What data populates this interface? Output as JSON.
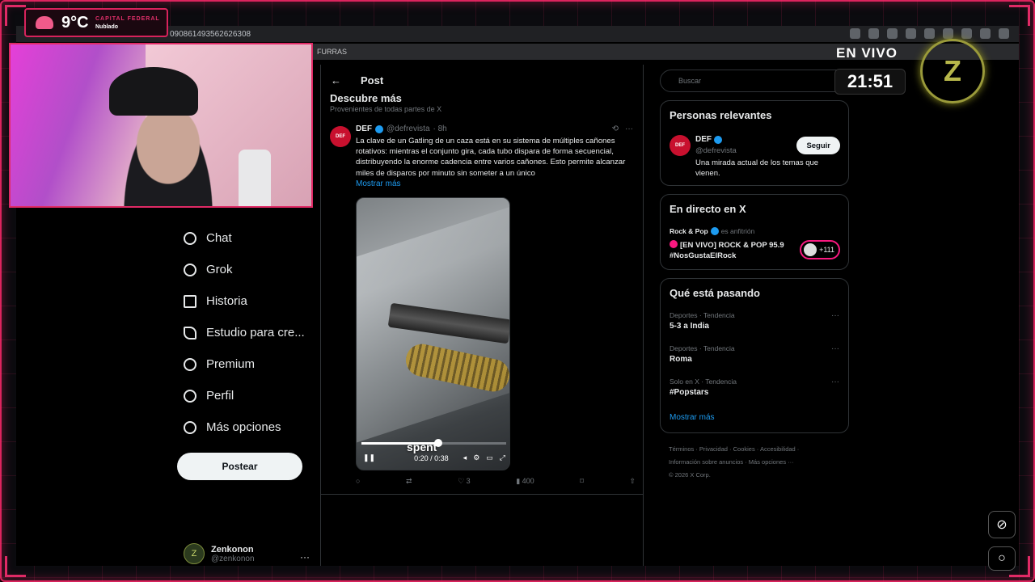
{
  "overlay": {
    "weather": {
      "temp": "9°C",
      "city": "CAPITAL FEDERAL",
      "condition": "Nublado"
    },
    "live_label": "EN VIVO",
    "clock": "21:51",
    "logo": "Z"
  },
  "browser": {
    "url": "090861493562626308",
    "bookmark": "FURRAS"
  },
  "nav": {
    "items": [
      {
        "label": "Chat",
        "icon": "chat-icon"
      },
      {
        "label": "Grok",
        "icon": "grok-icon"
      },
      {
        "label": "Historia",
        "icon": "bookmark-icon"
      },
      {
        "label": "Estudio para cre...",
        "icon": "rocket-icon"
      },
      {
        "label": "Premium",
        "icon": "verified-icon"
      },
      {
        "label": "Perfil",
        "icon": "person-icon"
      },
      {
        "label": "Más opciones",
        "icon": "more-icon"
      }
    ],
    "post_button": "Postear",
    "account": {
      "name": "Zenkonon",
      "handle": "@zenkonon",
      "more": "···"
    }
  },
  "main": {
    "header": {
      "back": "←",
      "title": "Post"
    },
    "discover": {
      "title": "Descubre más",
      "subtitle": "Provenientes de todas partes de X"
    },
    "tweet": {
      "avatar": "DEF",
      "name": "DEF",
      "handle": "@defrevista",
      "time": "· 8h",
      "text": "La clave de un Gatling de un caza está en su sistema de múltiples cañones rotativos: mientras el conjunto gira, cada tubo dispara de forma secuencial, distribuyendo la enorme cadencia entre varios cañones. Esto permite alcanzar miles de disparos por minuto sin someter a un único",
      "show_more": "Mostrar más",
      "video": {
        "caption": "spent",
        "time": "0:20 / 0:38",
        "progress": 0.53
      },
      "stats": {
        "likes": "3",
        "views": "400"
      }
    }
  },
  "right": {
    "search_placeholder": "Buscar",
    "relevant": {
      "title": "Personas relevantes",
      "avatar": "DEF",
      "name": "DEF",
      "handle": "@defrevista",
      "bio": "Una mirada actual de los temas que vienen.",
      "follow": "Seguir"
    },
    "live": {
      "title": "En directo en X",
      "host": "Rock & Pop",
      "host_role": "es anfitrión",
      "stream_title": "[EN VIVO] ROCK & POP 95.9 #NosGustaElRock",
      "count": "+111"
    },
    "trends": {
      "title": "Qué está pasando",
      "items": [
        {
          "category": "Deportes · Tendencia",
          "name": "5-3 a India"
        },
        {
          "category": "Deportes · Tendencia",
          "name": "Roma"
        },
        {
          "category": "Solo en X · Tendencia",
          "name": "#Popstars"
        }
      ],
      "show_more": "Mostrar más"
    },
    "footer": {
      "line1": "Términos · Privacidad · Cookies · Accesibilidad ·",
      "line2": "Información sobre anuncios · Más opciones ···",
      "line3": "© 2026 X Corp."
    }
  }
}
